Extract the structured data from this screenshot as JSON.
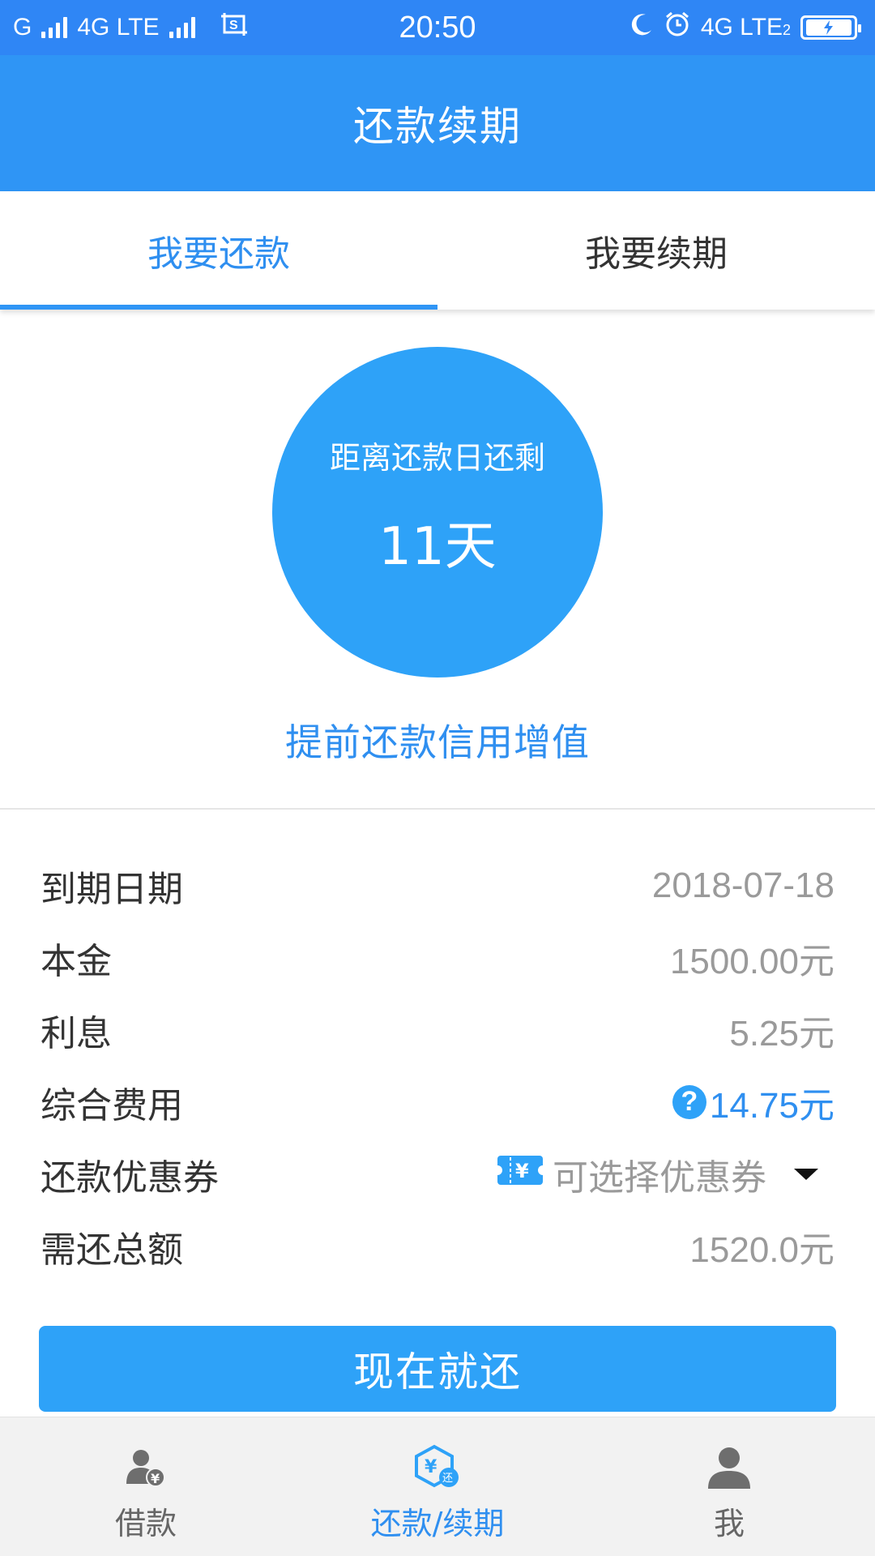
{
  "status_bar": {
    "carrier1": "G",
    "network1": "4G LTE",
    "time": "20:50",
    "network2": "4G LTE",
    "network2_sub": "2",
    "icons": [
      "signal-icon",
      "screenshot-icon",
      "moon-icon",
      "alarm-icon",
      "battery-charging-icon"
    ]
  },
  "header": {
    "title": "还款续期"
  },
  "tabs": [
    {
      "label": "我要还款",
      "active": true
    },
    {
      "label": "我要续期",
      "active": false
    }
  ],
  "countdown": {
    "label": "距离还款日还剩",
    "days": "11天"
  },
  "promo_text": "提前还款信用增值",
  "details": {
    "due_date": {
      "label": "到期日期",
      "value": "2018-07-18"
    },
    "principal": {
      "label": "本金",
      "value": "1500.00元"
    },
    "interest": {
      "label": "利息",
      "value": "5.25元"
    },
    "fees": {
      "label": "综合费用",
      "value": "14.75元",
      "help_icon": "?"
    },
    "coupon": {
      "label": "还款优惠券",
      "value": "可选择优惠券"
    },
    "total": {
      "label": "需还总额",
      "value": "1520.0元"
    }
  },
  "pay_button": {
    "label": "现在就还"
  },
  "bottom_nav": [
    {
      "label": "借款",
      "icon": "borrow-icon",
      "active": false
    },
    {
      "label": "还款/续期",
      "icon": "repay-icon",
      "active": true
    },
    {
      "label": "我",
      "icon": "profile-icon",
      "active": false
    }
  ],
  "colors": {
    "status_bar": "#2f86f5",
    "header": "#2f95f5",
    "accent": "#2f8ff0",
    "circle": "#2ea2f8",
    "nav_bg": "#f2f2f2"
  }
}
